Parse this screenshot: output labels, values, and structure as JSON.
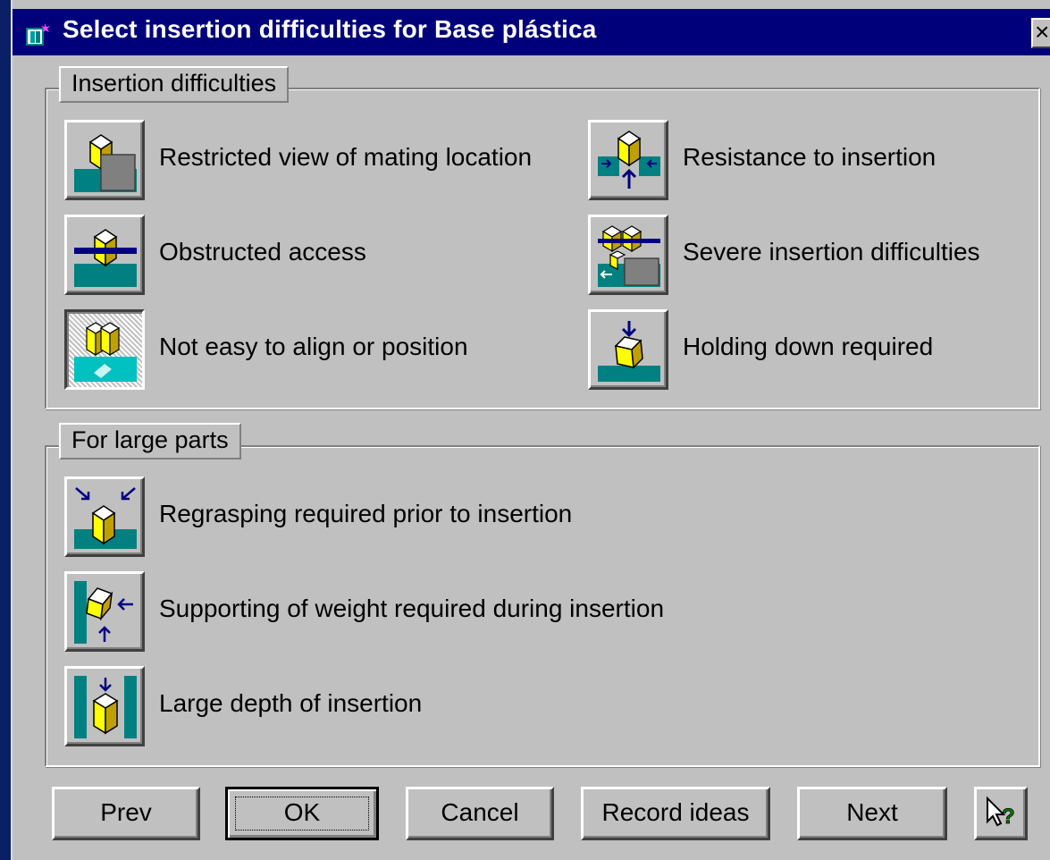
{
  "window": {
    "title": "Select insertion difficulties for Base plástica",
    "close_label": "×"
  },
  "groups": {
    "insertion": {
      "legend": "Insertion difficulties",
      "options": [
        {
          "label": "Restricted view of mating location",
          "icon": "restricted-view-icon",
          "pressed": false
        },
        {
          "label": "Resistance to insertion",
          "icon": "resistance-icon",
          "pressed": false
        },
        {
          "label": "Obstructed access",
          "icon": "obstructed-access-icon",
          "pressed": false
        },
        {
          "label": "Severe insertion difficulties",
          "icon": "severe-difficulties-icon",
          "pressed": false
        },
        {
          "label": "Not easy to align or position",
          "icon": "align-position-icon",
          "pressed": true
        },
        {
          "label": "Holding down required",
          "icon": "holding-down-icon",
          "pressed": false
        }
      ]
    },
    "large_parts": {
      "legend": "For large parts",
      "options": [
        {
          "label": "Regrasping required prior to insertion",
          "icon": "regrasping-icon",
          "pressed": false
        },
        {
          "label": "Supporting of weight required during insertion",
          "icon": "supporting-weight-icon",
          "pressed": false
        },
        {
          "label": "Large depth of insertion",
          "icon": "large-depth-icon",
          "pressed": false
        }
      ]
    }
  },
  "buttons": {
    "prev": "Prev",
    "ok": "OK",
    "cancel": "Cancel",
    "record_ideas": "Record ideas",
    "next": "Next"
  },
  "colors": {
    "titlebar": "#00007b",
    "face": "#c0c0c0",
    "teal": "#008080",
    "cube_yellow": "#ffff00",
    "arrow_blue": "#000080"
  }
}
